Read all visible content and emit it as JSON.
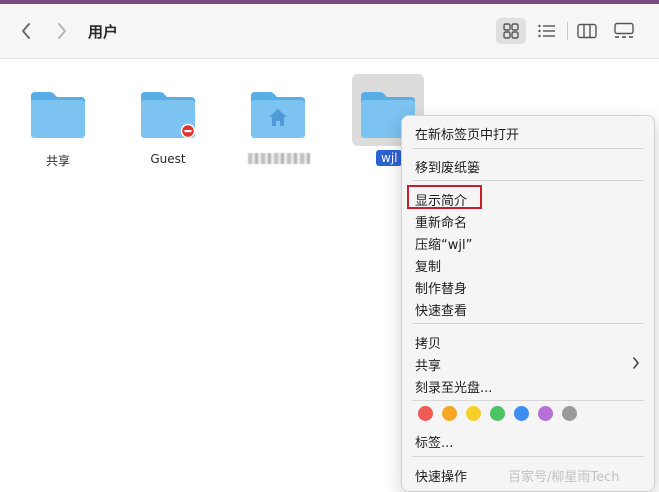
{
  "window": {
    "title": "用户"
  },
  "folders": [
    {
      "name": "共享"
    },
    {
      "name": "Guest"
    },
    {
      "name": ""
    },
    {
      "name": "wjl"
    }
  ],
  "context_menu": {
    "open_in_new_tab": "在新标签页中打开",
    "move_to_trash": "移到废纸篓",
    "get_info": "显示简介",
    "rename": "重新命名",
    "compress": "压缩“wjl”",
    "duplicate": "复制",
    "make_alias": "制作替身",
    "quick_look": "快速查看",
    "copy": "拷贝",
    "share": "共享",
    "burn_to_disc": "刻录至光盘...",
    "tags": "标签...",
    "quick_actions": "快速操作"
  },
  "tag_colors": [
    "#ef5a52",
    "#f5a623",
    "#f6cf2a",
    "#4cc463",
    "#3e8ef0",
    "#b56fd6",
    "#9a9a9a"
  ],
  "watermark": "百家号/柳星雨Tech"
}
